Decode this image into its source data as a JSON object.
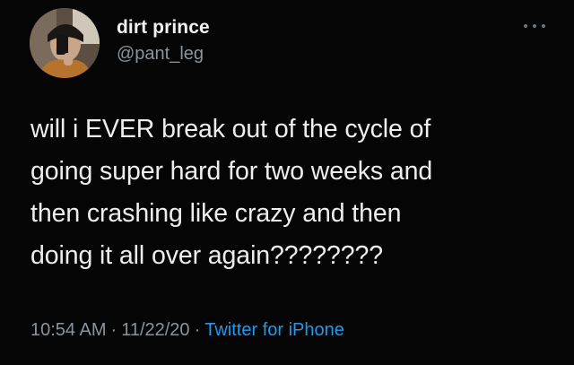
{
  "tweet": {
    "author": {
      "display_name": "dirt prince",
      "handle": "@pant_leg"
    },
    "more_icon": "more-horizontal-icon",
    "text_lines": [
      "will i EVER break out of the cycle of",
      "going super hard for two weeks and",
      "then crashing like crazy and then",
      "doing it all over again????????"
    ],
    "time": "10:54 AM",
    "date": "11/22/20",
    "separator": "·",
    "source": "Twitter for iPhone"
  },
  "colors": {
    "background": "#050505",
    "primary_text": "#eeeeee",
    "secondary_text": "#8b949b",
    "link": "#1d9bf0"
  }
}
